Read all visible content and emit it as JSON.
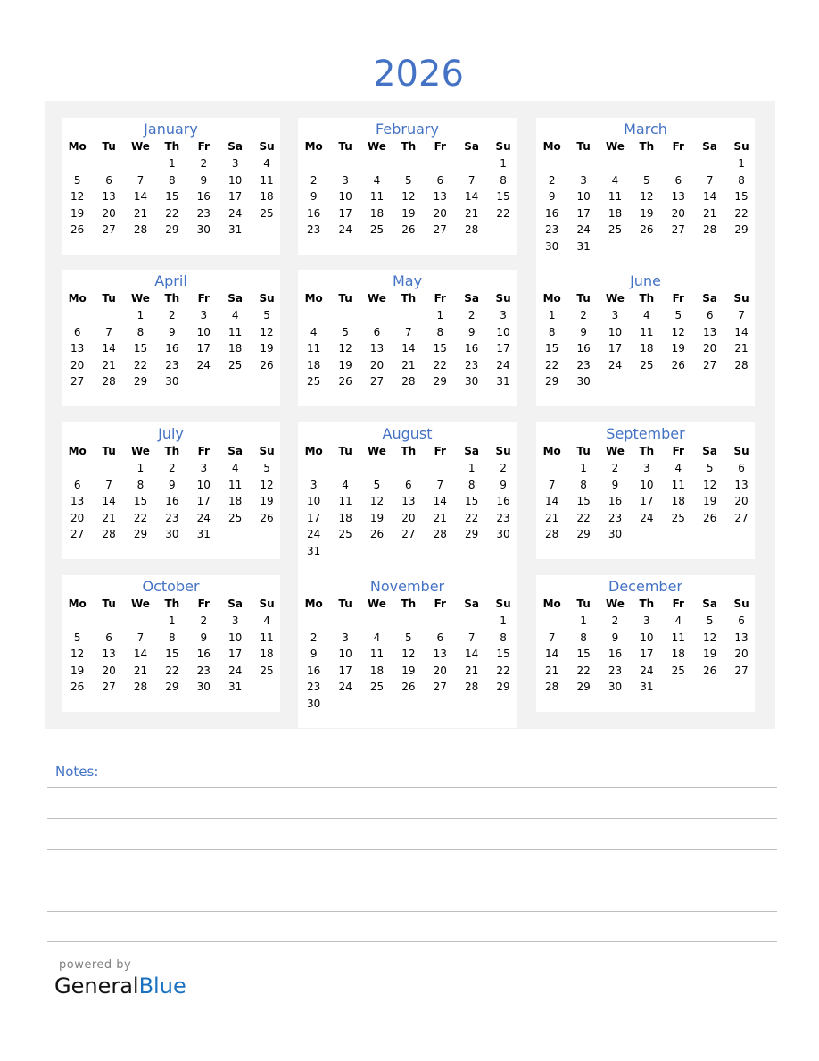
{
  "title": "2026",
  "weekdays": [
    "Mo",
    "Tu",
    "We",
    "Th",
    "Fr",
    "Sa",
    "Su"
  ],
  "months": [
    {
      "name": "January",
      "offset": 3,
      "days": 31
    },
    {
      "name": "February",
      "offset": 6,
      "days": 28
    },
    {
      "name": "March",
      "offset": 6,
      "days": 31
    },
    {
      "name": "April",
      "offset": 2,
      "days": 30
    },
    {
      "name": "May",
      "offset": 4,
      "days": 31
    },
    {
      "name": "June",
      "offset": 0,
      "days": 30
    },
    {
      "name": "July",
      "offset": 2,
      "days": 31
    },
    {
      "name": "August",
      "offset": 5,
      "days": 31
    },
    {
      "name": "September",
      "offset": 1,
      "days": 30
    },
    {
      "name": "October",
      "offset": 3,
      "days": 31
    },
    {
      "name": "November",
      "offset": 6,
      "days": 30
    },
    {
      "name": "December",
      "offset": 1,
      "days": 31
    }
  ],
  "notes": {
    "label": "Notes:"
  },
  "footer": {
    "powered": "powered by",
    "brand_a": "General",
    "brand_b": "Blue"
  },
  "colors": {
    "accent": "#4472c4",
    "brand_blue": "#1a72c0",
    "panel": "#f2f2f2"
  }
}
